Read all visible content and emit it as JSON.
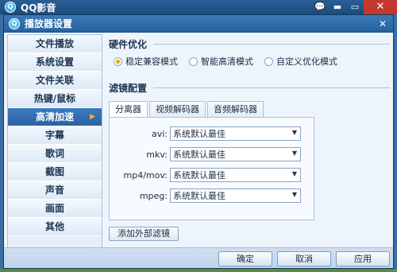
{
  "window": {
    "title": "QQ影音",
    "controls": [
      "💬",
      "▬",
      "▭",
      "✕"
    ]
  },
  "dialog": {
    "title": "播放器设置",
    "close": "✕"
  },
  "sidebar": {
    "items": [
      {
        "label": "文件播放"
      },
      {
        "label": "系统设置"
      },
      {
        "label": "文件关联"
      },
      {
        "label": "热键/鼠标"
      },
      {
        "label": "高清加速",
        "active": true
      },
      {
        "label": "字幕"
      },
      {
        "label": "歌词"
      },
      {
        "label": "截图"
      },
      {
        "label": "声音"
      },
      {
        "label": "画面"
      },
      {
        "label": "其他"
      }
    ],
    "active_arrow": "▶"
  },
  "hardware": {
    "title": "硬件优化",
    "options": [
      "稳定兼容模式",
      "智能高清模式",
      "自定义优化模式"
    ],
    "selected": "稳定兼容模式"
  },
  "filter": {
    "title": "滤镜配置",
    "tabs": [
      "分离器",
      "视频解码器",
      "音频解码器"
    ],
    "active_tab": "分离器",
    "rows": [
      {
        "label": "avi:",
        "value": "系统默认最佳"
      },
      {
        "label": "mkv:",
        "value": "系统默认最佳"
      },
      {
        "label": "mp4/mov:",
        "value": "系统默认最佳"
      },
      {
        "label": "mpeg:",
        "value": "系统默认最佳"
      }
    ],
    "add_button": "添加外部滤镜"
  },
  "footer": {
    "ok": "确定",
    "cancel": "取消",
    "apply": "应用"
  },
  "icons": {
    "app": "qq-player-logo-icon",
    "radio": "radio-icon",
    "dropdown": "dropdown-arrow-icon"
  },
  "colors": {
    "accent": "#2a62a2",
    "radio_checked": "#e6a400",
    "close_red": "#c4392d"
  }
}
